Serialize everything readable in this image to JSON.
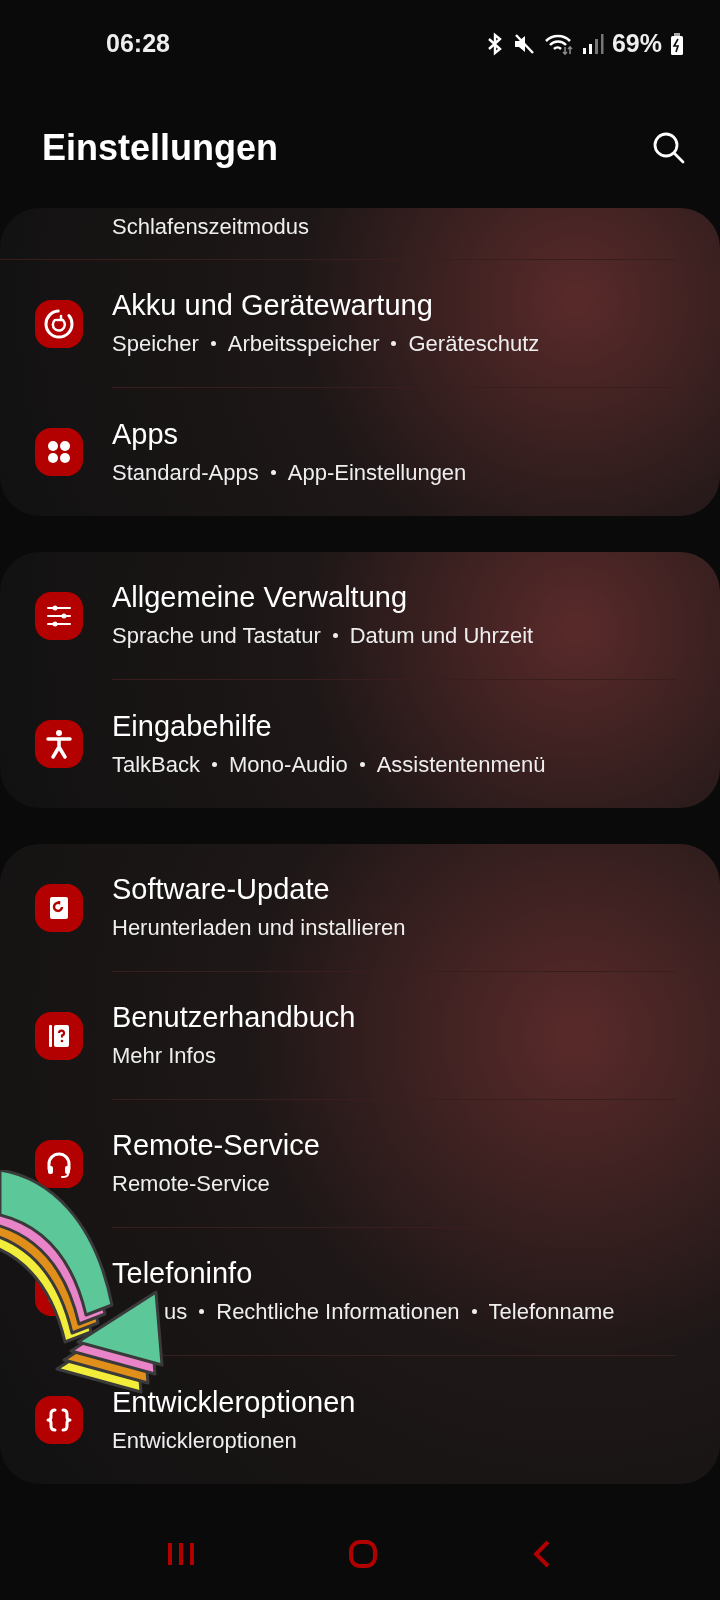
{
  "status_bar": {
    "time": "06:28",
    "battery": "69%"
  },
  "header": {
    "title": "Einstellungen"
  },
  "sections": [
    {
      "leading_text": "Schlafenszeitmodus",
      "items": [
        {
          "title": "Akku und Gerätewartung",
          "subtitle": [
            "Speicher",
            "Arbeitsspeicher",
            "Geräteschutz"
          ]
        },
        {
          "title": "Apps",
          "subtitle": [
            "Standard-Apps",
            "App-Einstellungen"
          ]
        }
      ]
    },
    {
      "items": [
        {
          "title": "Allgemeine Verwaltung",
          "subtitle": [
            "Sprache und Tastatur",
            "Datum und Uhrzeit"
          ]
        },
        {
          "title": "Eingabehilfe",
          "subtitle": [
            "TalkBack",
            "Mono-Audio",
            "Assistentenmenü"
          ]
        }
      ]
    },
    {
      "items": [
        {
          "title": "Software-Update",
          "subtitle": [
            "Herunterladen und installieren"
          ]
        },
        {
          "title": "Benutzerhandbuch",
          "subtitle": [
            "Mehr Infos"
          ]
        },
        {
          "title": "Remote-Service",
          "subtitle": [
            "Remote-Service"
          ]
        },
        {
          "title": "Telefoninfo",
          "subtitle": [
            "us",
            "Rechtliche Informationen",
            "Telefonname"
          ],
          "covered": true
        },
        {
          "title": "Entwickleroptionen",
          "subtitle": [
            "Entwickleroptionen"
          ]
        }
      ]
    }
  ]
}
